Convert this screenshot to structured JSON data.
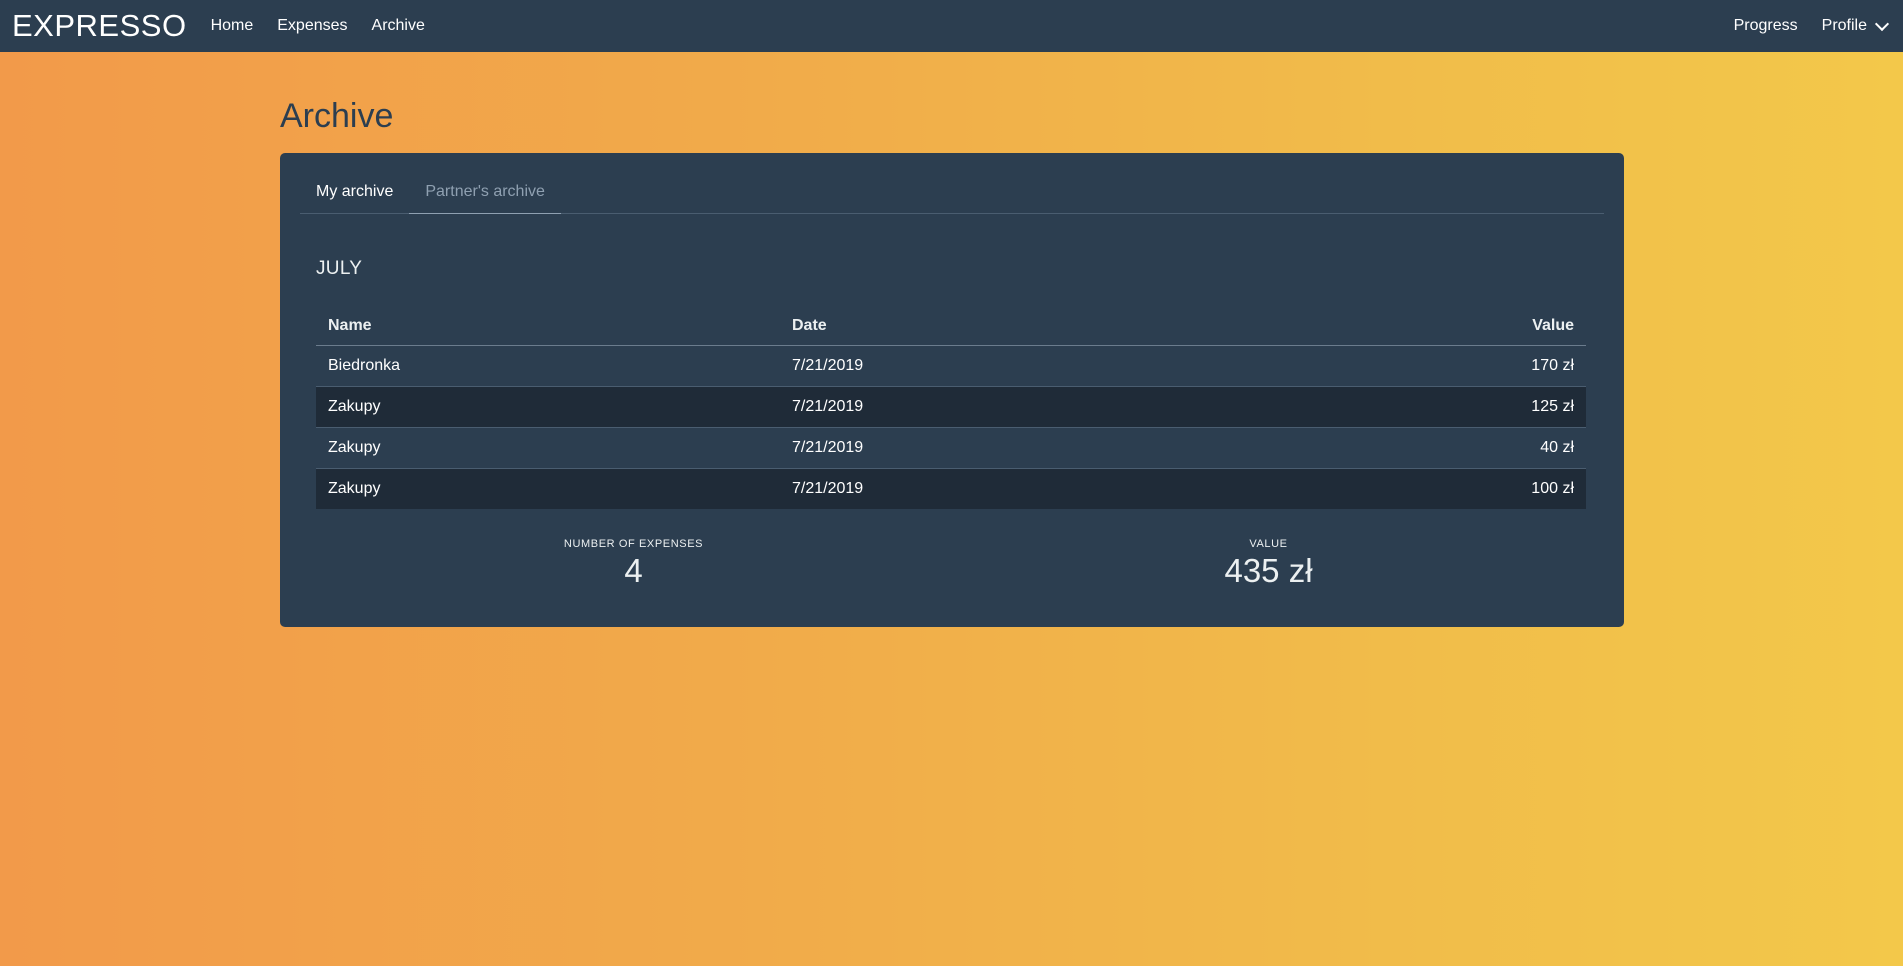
{
  "nav": {
    "brand": "EXPRESSO",
    "links": [
      "Home",
      "Expenses",
      "Archive"
    ],
    "right": [
      "Progress",
      "Profile"
    ]
  },
  "page": {
    "title": "Archive"
  },
  "tabs": [
    "My archive",
    "Partner's archive"
  ],
  "month": "JULY",
  "table": {
    "headers": [
      "Name",
      "Date",
      "Value"
    ],
    "rows": [
      [
        "Biedronka",
        "7/21/2019",
        "170 zł"
      ],
      [
        "Zakupy",
        "7/21/2019",
        "125 zł"
      ],
      [
        "Zakupy",
        "7/21/2019",
        "40 zł"
      ],
      [
        "Zakupy",
        "7/21/2019",
        "100 zł"
      ]
    ]
  },
  "summary": {
    "count_label": "NUMBER OF EXPENSES",
    "count_value": "4",
    "value_label": "VALUE",
    "value_total": "435 zł"
  },
  "colors": {
    "nav": "#2c3e50",
    "card": "#2c3e50",
    "row_alt": "#1f2b38"
  }
}
